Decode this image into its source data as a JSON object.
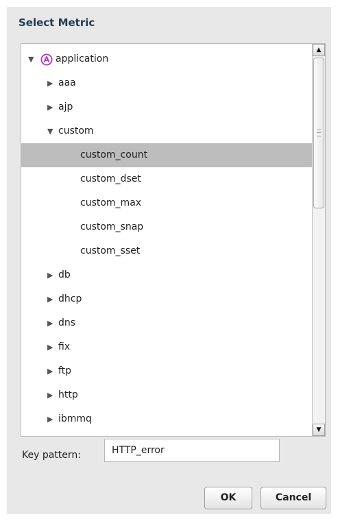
{
  "dialog": {
    "title": "Select Metric"
  },
  "tree": {
    "items": [
      {
        "label": "application",
        "arrow": "▼",
        "icon": "application-circle-a-icon"
      },
      {
        "label": "aaa",
        "arrow": "▶"
      },
      {
        "label": "ajp",
        "arrow": "▶"
      },
      {
        "label": "custom",
        "arrow": "▼"
      },
      {
        "label": "custom_count",
        "arrow": ""
      },
      {
        "label": "custom_dset",
        "arrow": ""
      },
      {
        "label": "custom_max",
        "arrow": ""
      },
      {
        "label": "custom_snap",
        "arrow": ""
      },
      {
        "label": "custom_sset",
        "arrow": ""
      },
      {
        "label": "db",
        "arrow": "▶"
      },
      {
        "label": "dhcp",
        "arrow": "▶"
      },
      {
        "label": "dns",
        "arrow": "▶"
      },
      {
        "label": "fix",
        "arrow": "▶"
      },
      {
        "label": "ftp",
        "arrow": "▶"
      },
      {
        "label": "http",
        "arrow": "▶"
      },
      {
        "label": "ibmmq",
        "arrow": "▶"
      }
    ],
    "selected_label": "custom_count",
    "scroll_up_glyph": "▲",
    "scroll_down_glyph": "▼"
  },
  "key_pattern": {
    "label": "Key pattern:",
    "value": "HTTP_error"
  },
  "buttons": {
    "ok": "OK",
    "cancel": "Cancel"
  },
  "colors": {
    "title": "#1d3a52",
    "selected_row": "#bdbdbd",
    "app_icon": "#b036c9"
  }
}
